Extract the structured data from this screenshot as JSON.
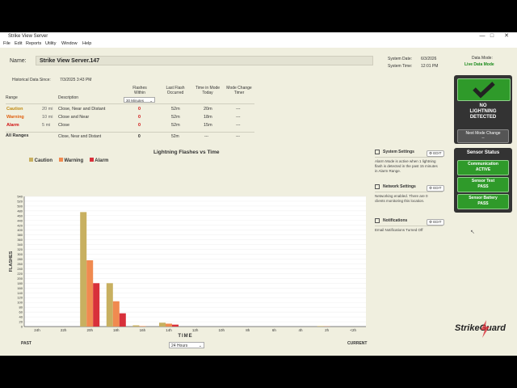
{
  "window": {
    "title": "Strike View Server",
    "controls": [
      "—",
      "□",
      "✕"
    ]
  },
  "menu": [
    "File",
    "Edit",
    "Reports",
    "Utility",
    "Window",
    "Help"
  ],
  "server": {
    "name_label": "Name:",
    "name_value": "Strike View Server.147",
    "historical_label": "Historical Data Since:",
    "historical_value": "7/3/2025 3:43 PM"
  },
  "system": {
    "date_label": "System Date:",
    "date_value": "6/3/2026",
    "time_label": "System Time:",
    "time_value": "12:01 PM",
    "mode_label": "Data Mode:",
    "mode_value": "Live Data Mode"
  },
  "table": {
    "headers": {
      "range": "Range",
      "description": "Description",
      "flashes": "Flashes Within",
      "last_flash": "Last Flash Occurred",
      "time_in_mode": "Time in Mode Today",
      "mode_change": "Mode Change Timer"
    },
    "window_select": "30 Minutes",
    "rows": [
      {
        "name": "Caution",
        "dist": "20 mi",
        "desc": "Close, Near and Distant",
        "flashes": "0",
        "last": "52m",
        "tim": "20m",
        "timer": "---",
        "color": "#c08a10"
      },
      {
        "name": "Warning",
        "dist": "10 mi",
        "desc": "Close and Near",
        "flashes": "0",
        "last": "52m",
        "tim": "18m",
        "timer": "---",
        "color": "#e06010"
      },
      {
        "name": "Alarm",
        "dist": "5 mi",
        "desc": "Close",
        "flashes": "0",
        "last": "52m",
        "tim": "15m",
        "timer": "---",
        "color": "#d01010"
      }
    ],
    "all": {
      "name": "All Ranges",
      "desc": "Close, Near and Distant",
      "flashes": "0",
      "last": "52m",
      "tim": "---",
      "timer": "---"
    }
  },
  "chart_data": {
    "type": "bar",
    "title": "Lightning Flashes vs Time",
    "xlabel": "TIME",
    "ylabel": "FLASHES",
    "ylim": [
      0,
      540
    ],
    "yticks": [
      0,
      20,
      40,
      60,
      80,
      100,
      120,
      140,
      160,
      180,
      200,
      220,
      240,
      260,
      280,
      300,
      320,
      340,
      360,
      380,
      400,
      420,
      440,
      460,
      480,
      500,
      520,
      540
    ],
    "x_ticks": [
      "24h",
      "22h",
      "20h",
      "18h",
      "16h",
      "14h",
      "12h",
      "10h",
      "8h",
      "6h",
      "4h",
      "2h",
      "<2h"
    ],
    "legend": [
      "Caution",
      "Warning",
      "Alarm"
    ],
    "colors": [
      "#c8b060",
      "#f08a50",
      "#d8303a"
    ],
    "groups": [
      {
        "x_hours_ago": 20,
        "values": [
          475,
          275,
          180
        ]
      },
      {
        "x_hours_ago": 18,
        "values": [
          180,
          105,
          55
        ]
      },
      {
        "x_hours_ago": 16,
        "values": [
          5,
          2,
          0
        ]
      },
      {
        "x_hours_ago": 14,
        "values": [
          16,
          12,
          8
        ]
      },
      {
        "x_hours_ago": 2,
        "values": [
          2,
          1,
          0
        ]
      }
    ],
    "range_select": "24 Hours",
    "left_label": "PAST",
    "right_label": "CURRENT"
  },
  "status_panel": {
    "no_lightning": [
      "NO",
      "LIGHTNING",
      "DETECTED"
    ],
    "next_mode_label": "Next Mode Change",
    "next_mode_value": "--"
  },
  "sensor_status": {
    "title": "Sensor Status",
    "items": [
      [
        "Communication",
        "ACTIVE"
      ],
      [
        "Sensor Test",
        "PASS"
      ],
      [
        "Sensor Battery",
        "PASS"
      ]
    ]
  },
  "settings": {
    "system_title": "System Settings",
    "system_text": [
      "Alarm Mode is active when 1 lightning",
      "flash is detected in the past 15 minutes",
      "in Alarm Range."
    ],
    "network_title": "Network Settings",
    "network_text": [
      "Networking enabled. There are 0",
      "clients monitoring this location."
    ],
    "notif_title": "Notifications",
    "notif_text": [
      "Email Notifications Turned Off"
    ],
    "edit_label": "EDIT"
  },
  "brand": {
    "name": "StrikeGuard"
  }
}
